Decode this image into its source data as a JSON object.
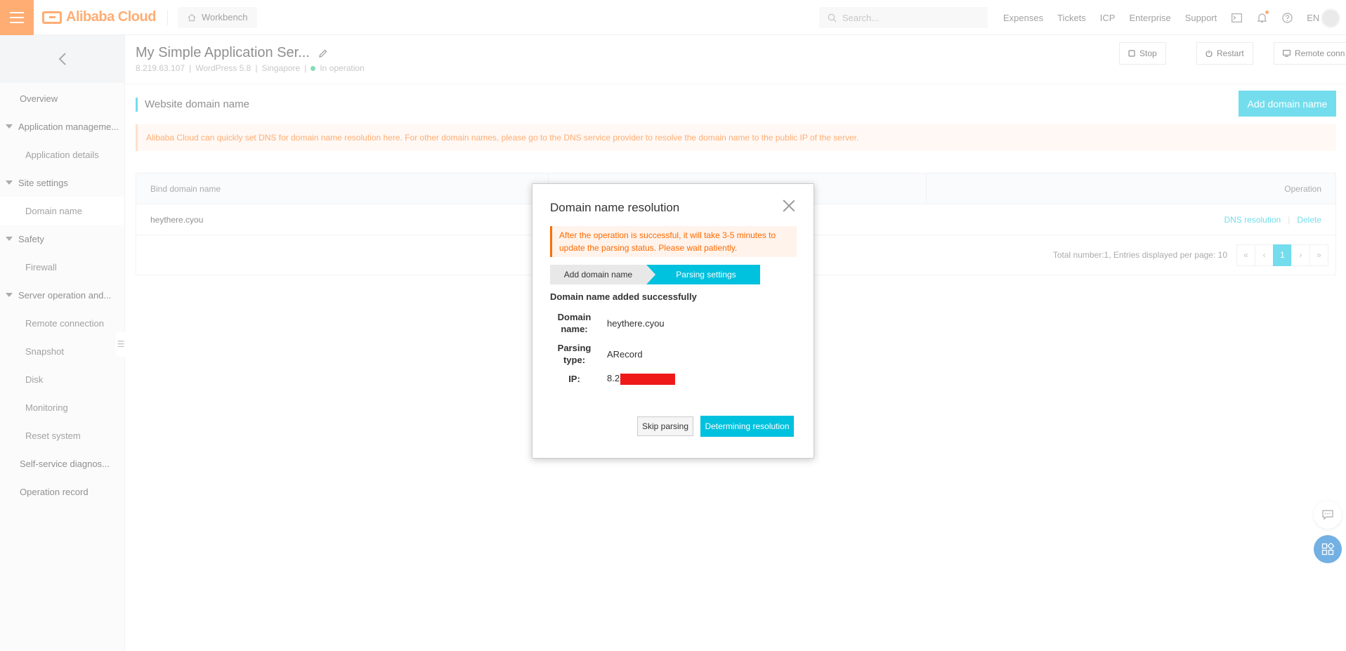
{
  "topbar": {
    "brand": "Alibaba Cloud",
    "workbench": "Workbench",
    "search_placeholder": "Search...",
    "links": [
      "Expenses",
      "Tickets",
      "ICP",
      "Enterprise",
      "Support"
    ],
    "lang": "EN"
  },
  "sidebar": {
    "items": [
      {
        "label": "Overview",
        "kind": "l1"
      },
      {
        "label": "Application manageme...",
        "kind": "group"
      },
      {
        "label": "Application details",
        "kind": "l2"
      },
      {
        "label": "Site settings",
        "kind": "group"
      },
      {
        "label": "Domain name",
        "kind": "l2",
        "active": true
      },
      {
        "label": "Safety",
        "kind": "group"
      },
      {
        "label": "Firewall",
        "kind": "l2"
      },
      {
        "label": "Server operation and...",
        "kind": "group"
      },
      {
        "label": "Remote connection",
        "kind": "l2"
      },
      {
        "label": "Snapshot",
        "kind": "l2"
      },
      {
        "label": "Disk",
        "kind": "l2"
      },
      {
        "label": "Monitoring",
        "kind": "l2"
      },
      {
        "label": "Reset system",
        "kind": "l2"
      },
      {
        "label": "Self-service diagnos...",
        "kind": "l1"
      },
      {
        "label": "Operation record",
        "kind": "l1"
      }
    ]
  },
  "header": {
    "title": "My Simple Application Ser...",
    "ip": "8.219.63.107",
    "app": "WordPress 5.8",
    "region": "Singapore",
    "status": "In operation",
    "sep": "|",
    "stop": "Stop",
    "restart": "Restart",
    "remote": "Remote conn"
  },
  "content": {
    "section_title": "Website domain name",
    "add_button": "Add domain name",
    "notice": "Alibaba Cloud can quickly set DNS for domain name resolution here. For other domain names, please go to the DNS service provider to resolve the domain name to the public IP of the server.",
    "table": {
      "col_bind": "Bind domain name",
      "col_operation": "Operation",
      "row_domain": "heythere.cyou",
      "op_dns": "DNS resolution",
      "op_sep": "|",
      "op_delete": "Delete",
      "footer_total": "Total number:1, Entries displayed per page: 10",
      "pager": [
        "«",
        "‹",
        "1",
        "›",
        "»"
      ]
    }
  },
  "modal": {
    "title": "Domain name resolution",
    "warning": "After the operation is successful, it will take 3-5 minutes to update the parsing status. Please wait patiently.",
    "step1": "Add domain name",
    "step2": "Parsing settings",
    "success": "Domain name added successfully",
    "domain_label": "Domain name:",
    "domain_value": "heythere.cyou",
    "type_label": "Parsing type:",
    "type_value": "ARecord",
    "ip_label": "IP:",
    "ip_value": "8.2",
    "skip": "Skip parsing",
    "determine": "Determining resolution"
  },
  "colors": {
    "accent": "#00c1de",
    "brand": "#ff6a00",
    "status_green": "#1fc17c",
    "redaction": "#ee1a1a"
  },
  "icons": [
    "menu-icon",
    "home-icon",
    "search-icon",
    "terminal-icon",
    "bell-icon",
    "help-icon",
    "back-arrow-icon",
    "edit-icon",
    "stop-icon",
    "power-icon",
    "monitor-icon",
    "close-icon",
    "chat-icon",
    "apps-icon"
  ]
}
